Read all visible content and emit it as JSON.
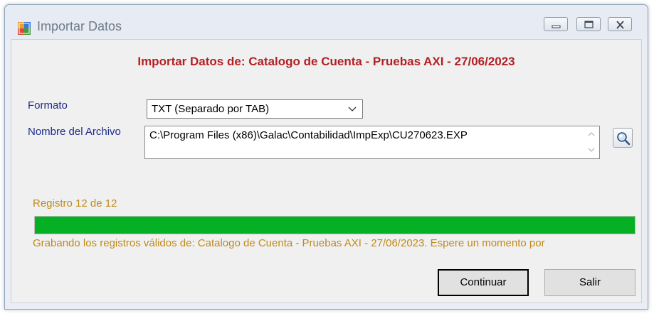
{
  "window": {
    "title": "Importar Datos",
    "icon": "app-window-icon"
  },
  "controls": {
    "minimize": "minimize-icon",
    "maximize": "maximize-icon",
    "close": "close-icon"
  },
  "heading": "Importar Datos de: Catalogo de Cuenta - Pruebas AXI - 27/06/2023",
  "form": {
    "format_label": "Formato",
    "format_value": "TXT (Separado por TAB)",
    "file_label": "Nombre del Archivo",
    "file_value": "C:\\Program Files (x86)\\Galac\\Contabilidad\\ImpExp\\CU270623.EXP"
  },
  "progress": {
    "record_text": "Registro 12 de 12",
    "percent": 100,
    "status_text": "Grabando los registros válidos de: Catalogo de Cuenta - Pruebas AXI - 27/06/2023. Espere un momento por"
  },
  "buttons": {
    "continue_label": "Continuar",
    "exit_label": "Salir"
  },
  "colors": {
    "heading": "#b22024",
    "label_blue": "#1f2a8c",
    "status_orange": "#c08a1a",
    "progress_green": "#06b025"
  }
}
